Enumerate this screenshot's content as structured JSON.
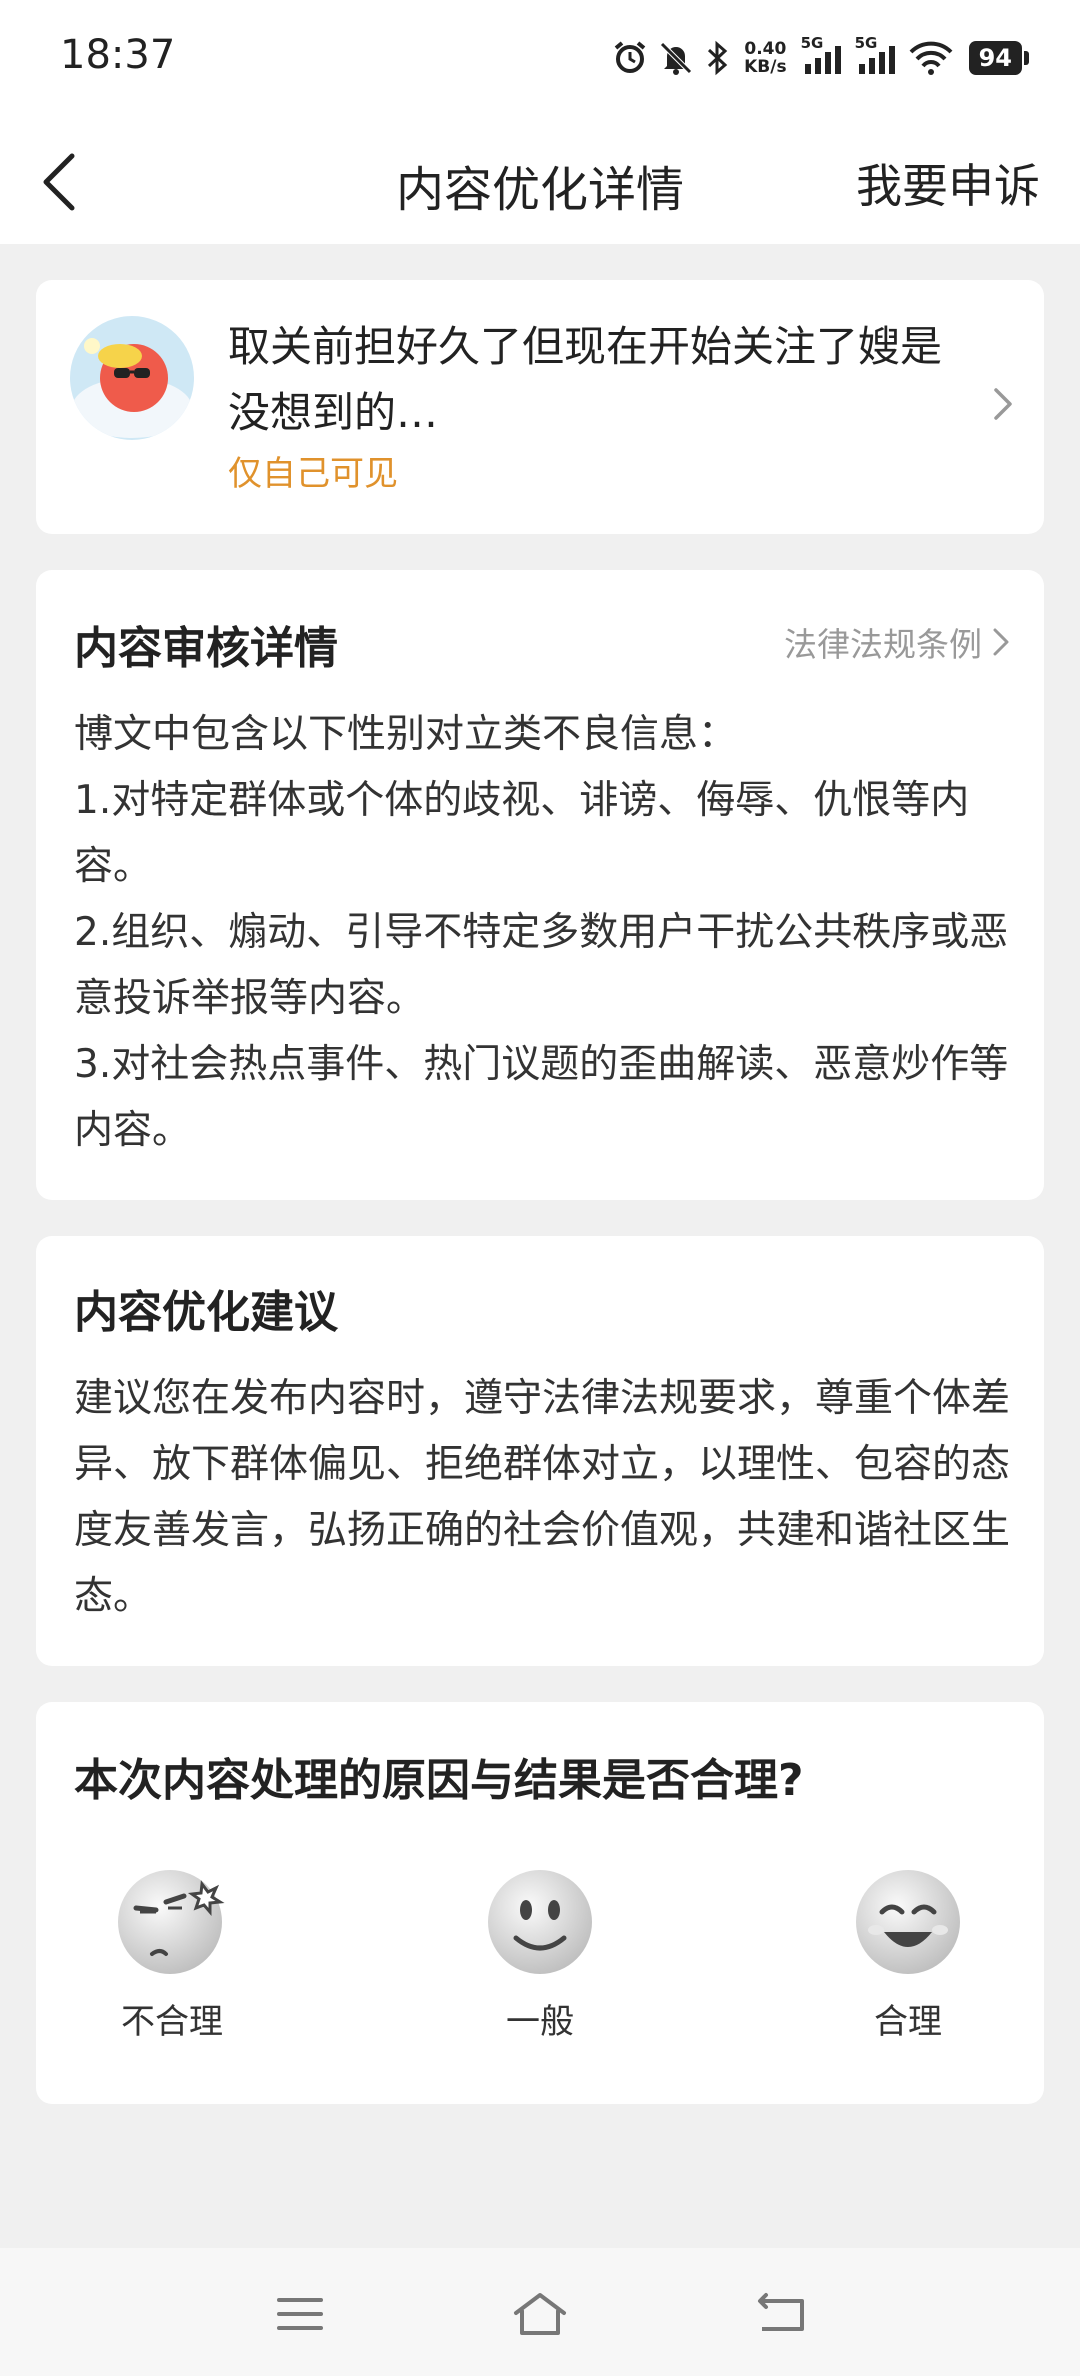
{
  "status_bar": {
    "time": "18:37",
    "net_speed_value": "0.40",
    "net_speed_unit": "KB/s",
    "signal1_label": "5G",
    "signal2_label": "5G",
    "battery": "94"
  },
  "header": {
    "title": "内容优化详情",
    "appeal_label": "我要申诉"
  },
  "post": {
    "text": "取关前担好久了但现在开始关注了嫂是没想到的…",
    "visibility": "仅自己可见"
  },
  "review": {
    "title": "内容审核详情",
    "law_link": "法律法规条例",
    "lines": [
      "博文中包含以下性别对立类不良信息：",
      "1.对特定群体或个体的歧视、诽谤、侮辱、仇恨等内容。",
      "2.组织、煽动、引导不特定多数用户干扰公共秩序或恶意投诉举报等内容。",
      "3.对社会热点事件、热门议题的歪曲解读、恶意炒作等内容。"
    ]
  },
  "suggestion": {
    "title": "内容优化建议",
    "body": "建议您在发布内容时，遵守法律法规要求，尊重个体差异、放下群体偏见、拒绝群体对立，以理性、包容的态度友善发言，弘扬正确的社会价值观，共建和谐社区生态。"
  },
  "feedback": {
    "question": "本次内容处理的原因与结果是否合理?",
    "options": [
      {
        "label": "不合理",
        "icon": "annoyed-face-icon"
      },
      {
        "label": "一般",
        "icon": "neutral-smile-face-icon"
      },
      {
        "label": "合理",
        "icon": "happy-face-icon"
      }
    ]
  },
  "colors": {
    "accent_orange": "#e0922c",
    "page_bg": "#f0f0f0",
    "card_bg": "#ffffff"
  }
}
